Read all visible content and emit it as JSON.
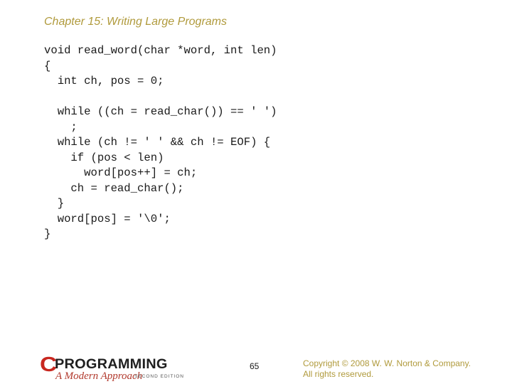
{
  "slide": {
    "title": "Chapter 15: Writing Large Programs",
    "code_lines": [
      "void read_word(char *word, int len)",
      "{",
      "  int ch, pos = 0;",
      "",
      "  while ((ch = read_char()) == ' ')",
      "    ;",
      "  while (ch != ' ' && ch != EOF) {",
      "    if (pos < len)",
      "      word[pos++] = ch;",
      "    ch = read_char();",
      "  }",
      "  word[pos] = '\\0';",
      "}"
    ]
  },
  "footer": {
    "logo": {
      "letter": "C",
      "main": "PROGRAMMING",
      "subtitle": "A Modern Approach",
      "edition": "SECOND EDITION"
    },
    "page_number": "65",
    "copyright_line1": "Copyright © 2008 W. W. Norton & Company.",
    "copyright_line2": "All rights reserved."
  },
  "colors": {
    "title": "#b09a3c",
    "logo_red": "#c8271f",
    "copyright": "#b09a3c"
  }
}
